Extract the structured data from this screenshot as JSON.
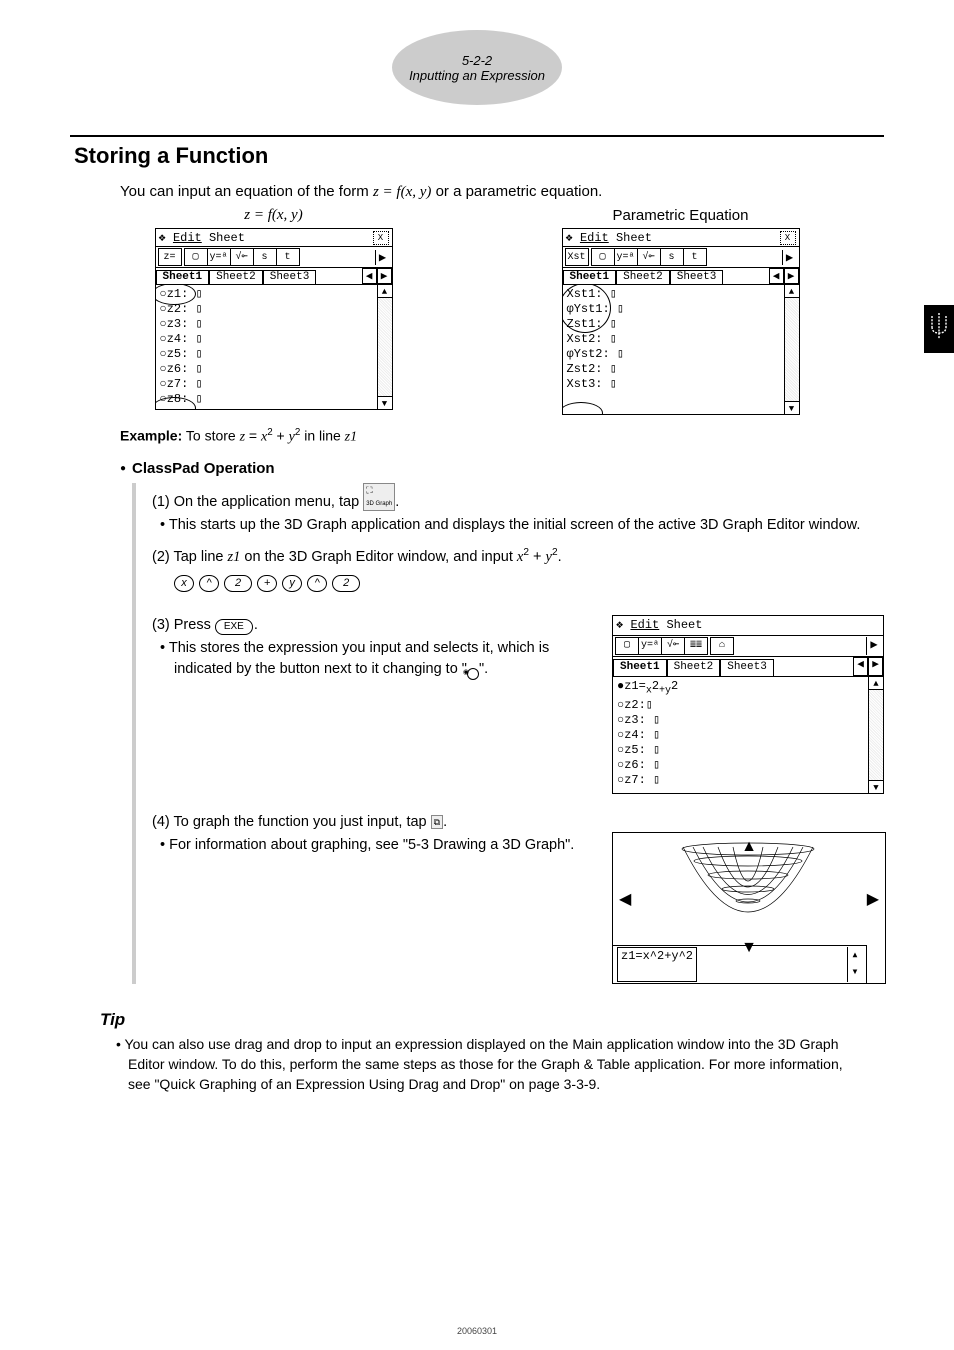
{
  "header": {
    "page_num": "5-2-2",
    "page_title": "Inputting an Expression"
  },
  "h1": "Storing a Function",
  "intro_pre": "You can input an equation of the form  ",
  "intro_eq": "z = f(x, y)",
  "intro_post": " or a parametric equation.",
  "left_col_title": "z = f(x, y)",
  "right_col_title": "Parametric Equation",
  "menubar": {
    "menu1": "Edit",
    "menu2": "Sheet",
    "close": "X"
  },
  "toolbar_left": {
    "mode": "z=",
    "b1": "▢",
    "b2": "y=ᵃ",
    "b3": "√⟜",
    "b4": "s",
    "b5": "t",
    "arrow": "▶"
  },
  "toolbar_right": {
    "mode": "Xst",
    "b1": "▢",
    "b2": "y=ᵃ",
    "b3": "√⟜",
    "b4": "s",
    "b5": "t",
    "arrow": "▶"
  },
  "tabs": {
    "t1": "Sheet1",
    "t2": "Sheet2",
    "t3": "Sheet3",
    "l": "◀",
    "r": "▶"
  },
  "left_lines": [
    "○z1: ▯",
    "○z2: ▯",
    "○z3: ▯",
    "○z4: ▯",
    "○z5: ▯",
    "○z6: ▯",
    "○z7: ▯",
    "○z8: ▯"
  ],
  "right_lines": [
    " Xst1: ▯",
    "φYst1: ▯",
    " Zst1: ▯",
    " Xst2: ▯",
    "φYst2: ▯",
    " Zst2: ▯",
    " Xst3: ▯"
  ],
  "example_label": "Example:",
  "example_pre": "  To store ",
  "example_eq": "z = x² + y²",
  "example_mid": " in line ",
  "example_line": "z1",
  "op_heading": "ClassPad Operation",
  "step1": "(1) On the application menu, tap ",
  "step1_icon": "3D Graph",
  "step1_bullet": "This starts up the 3D Graph application and displays the initial screen of the active 3D Graph Editor window.",
  "step2_a": "(2) Tap line ",
  "step2_z1": "z1",
  "step2_b": " on the 3D Graph Editor window, and input ",
  "step2_expr": "x² + y²",
  "keys": [
    "x",
    "^",
    "2",
    "+",
    "y",
    "^",
    "2"
  ],
  "step3": "(3) Press ",
  "exe_label": "EXE",
  "step3_bullet_a": "This stores the expression you input and selects it, which is indicated by the button next to it changing to \"",
  "step3_bullet_b": "\".",
  "fig3_toolbar": {
    "b1": "▢",
    "b2": "y=ᵃ",
    "b3": "√⟜",
    "b4": "≣≣",
    "b5": "⌂",
    "arrow": "▶"
  },
  "fig3_lines": [
    "●z1=ₓ2₊ᵧ2",
    "○z2:▯",
    "○z3: ▯",
    "○z4: ▯",
    "○z5: ▯",
    "○z6: ▯",
    "○z7: ▯"
  ],
  "fig3_line0_disp": "●z1=x²+y²",
  "step4": "(4) To graph the function you just input, tap ",
  "step4_icon": "⧉",
  "step4_bullet": "For information about graphing, see \"5-3 Drawing a 3D Graph\".",
  "graph_expr": "z1=x^2+y^2",
  "tip_h": "Tip",
  "tip_body": "You can also use drag and drop to input an expression displayed on the Main application window into the 3D Graph Editor window. To do this, perform the same steps as those for the Graph & Table application. For more information, see \"Quick Graphing of an Expression Using Drag and Drop\" on page 3-3-9.",
  "footer": "20060301"
}
